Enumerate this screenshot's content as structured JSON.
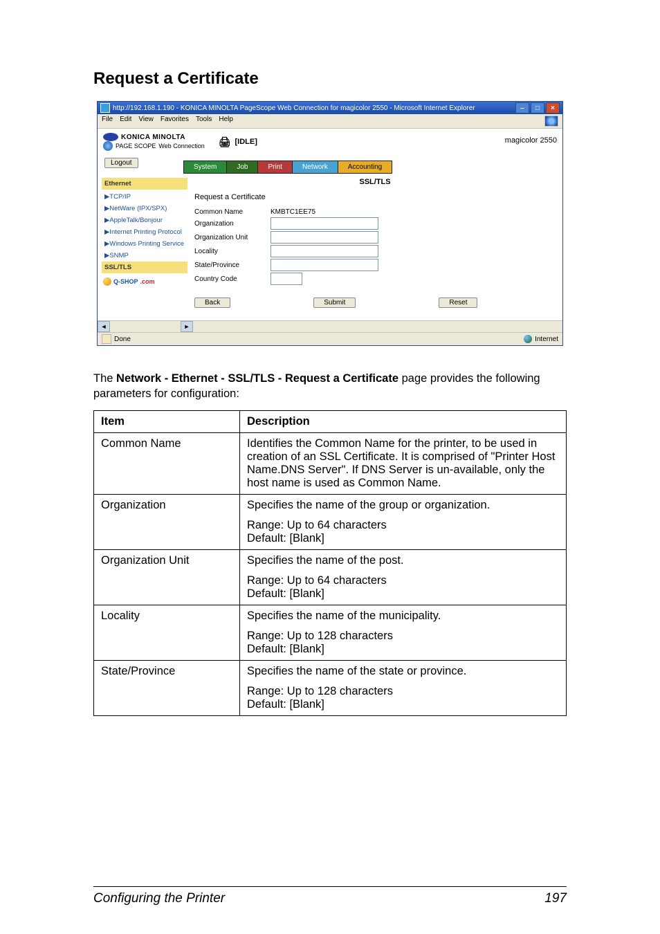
{
  "section_title": "Request a Certificate",
  "browser": {
    "title": "http://192.168.1.190 - KONICA MINOLTA PageScope Web Connection for magicolor 2550 - Microsoft Internet Explorer",
    "menu": {
      "file": "File",
      "edit": "Edit",
      "view": "View",
      "favorites": "Favorites",
      "tools": "Tools",
      "help": "Help"
    },
    "brand1": "KONICA MINOLTA",
    "brand2_a": "PAGE SCOPE",
    "brand2_b": "Web Connection",
    "status_label": "[IDLE]",
    "device": "magicolor 2550",
    "logout": "Logout",
    "tabs": {
      "system": "System",
      "job": "Job",
      "print": "Print",
      "network": "Network",
      "accounting": "Accounting"
    },
    "sidebar": {
      "head": "Ethernet",
      "tcpip": "▶TCP/IP",
      "netware": "▶NetWare (IPX/SPX)",
      "appletalk": "▶AppleTalk/Bonjour",
      "ipp": "▶Internet Printing Protocol",
      "winprint": "▶Windows Printing Service",
      "snmp": "▶SNMP",
      "ssl": "SSL/TLS"
    },
    "qshop_a": "Q-SHOP",
    "qshop_b": ".com",
    "main": {
      "subtitle": "SSL/TLS",
      "sub2": "Request a Certificate",
      "rows": {
        "common_name_lbl": "Common Name",
        "common_name_val": "KMBTC1EE75",
        "org_lbl": "Organization",
        "orgunit_lbl": "Organization Unit",
        "locality_lbl": "Locality",
        "state_lbl": "State/Province",
        "country_lbl": "Country Code"
      },
      "back": "Back",
      "submit": "Submit",
      "reset": "Reset"
    },
    "status_done": "Done",
    "status_zone": "Internet"
  },
  "paragraph_a": "The ",
  "paragraph_b": "Network -  Ethernet - SSL/TLS - Request a Certificate",
  "paragraph_c": " page provides the following parameters for configuration:",
  "table": {
    "h_item": "Item",
    "h_desc": "Description",
    "r1_item": "Common Name",
    "r1_desc": "Identifies the Common Name for the printer, to be used in creation of an SSL Certificate. It is comprised of \"Printer Host Name.DNS Server\". If DNS Server is un-available, only the host name is used as Common Name.",
    "r2_item": "Organization",
    "r2_desc": "Specifies the name of the group or organization.",
    "r2_range": "Range:    Up to 64 characters",
    "r2_default": "Default:   [Blank]",
    "r3_item": "Organization Unit",
    "r3_desc": "Specifies the name of the post.",
    "r3_range": "Range:    Up to 64 characters",
    "r3_default": "Default:   [Blank]",
    "r4_item": "Locality",
    "r4_desc": "Specifies the name of the municipality.",
    "r4_range": "Range:    Up to 128 characters",
    "r4_default": "Default:   [Blank]",
    "r5_item": "State/Province",
    "r5_desc": "Specifies the name of the state or province.",
    "r5_range": "Range:    Up to 128 characters",
    "r5_default": "Default:   [Blank]"
  },
  "footer_left": "Configuring the Printer",
  "footer_right": "197"
}
